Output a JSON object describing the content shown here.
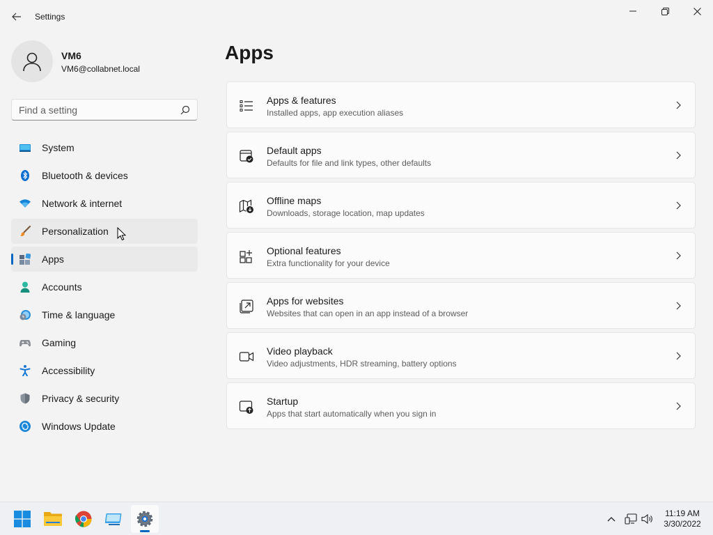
{
  "window": {
    "title": "Settings",
    "back_icon": "back-arrow-icon",
    "controls": [
      "minimize-icon",
      "maximize-icon",
      "close-icon"
    ]
  },
  "profile": {
    "name": "VM6",
    "email": "VM6@collabnet.local",
    "avatar_icon": "user-icon"
  },
  "search": {
    "placeholder": "Find a setting",
    "value": "",
    "icon": "search-icon"
  },
  "sidebar": {
    "items": [
      {
        "label": "System",
        "icon": "system-icon",
        "state": "normal"
      },
      {
        "label": "Bluetooth & devices",
        "icon": "bluetooth-icon",
        "state": "normal"
      },
      {
        "label": "Network & internet",
        "icon": "wifi-icon",
        "state": "normal"
      },
      {
        "label": "Personalization",
        "icon": "brush-icon",
        "state": "hover"
      },
      {
        "label": "Apps",
        "icon": "apps-icon",
        "state": "selected"
      },
      {
        "label": "Accounts",
        "icon": "accounts-icon",
        "state": "normal"
      },
      {
        "label": "Time & language",
        "icon": "clock-globe-icon",
        "state": "normal"
      },
      {
        "label": "Gaming",
        "icon": "gamepad-icon",
        "state": "normal"
      },
      {
        "label": "Accessibility",
        "icon": "accessibility-icon",
        "state": "normal"
      },
      {
        "label": "Privacy & security",
        "icon": "shield-icon",
        "state": "normal"
      },
      {
        "label": "Windows Update",
        "icon": "update-icon",
        "state": "normal"
      }
    ]
  },
  "main": {
    "title": "Apps",
    "cards": [
      {
        "title": "Apps & features",
        "subtitle": "Installed apps, app execution aliases",
        "icon": "list-icon"
      },
      {
        "title": "Default apps",
        "subtitle": "Defaults for file and link types, other defaults",
        "icon": "default-apps-icon"
      },
      {
        "title": "Offline maps",
        "subtitle": "Downloads, storage location, map updates",
        "icon": "map-download-icon"
      },
      {
        "title": "Optional features",
        "subtitle": "Extra functionality for your device",
        "icon": "grid-plus-icon"
      },
      {
        "title": "Apps for websites",
        "subtitle": "Websites that can open in an app instead of a browser",
        "icon": "open-external-icon"
      },
      {
        "title": "Video playback",
        "subtitle": "Video adjustments, HDR streaming, battery options",
        "icon": "video-camera-icon"
      },
      {
        "title": "Startup",
        "subtitle": "Apps that start automatically when you sign in",
        "icon": "startup-icon"
      }
    ]
  },
  "taskbar": {
    "apps": [
      "start-icon",
      "file-explorer-icon",
      "chrome-icon",
      "remote-desktop-icon",
      "settings-gear-icon"
    ],
    "active_app": "settings-gear-icon",
    "tray": [
      "chevron-up-icon",
      "network-icon",
      "volume-icon"
    ],
    "time": "11:19 AM",
    "date": "3/30/2022"
  },
  "colors": {
    "accent": "#0067c0",
    "background": "#f3f3f3",
    "card": "#fbfbfb"
  }
}
